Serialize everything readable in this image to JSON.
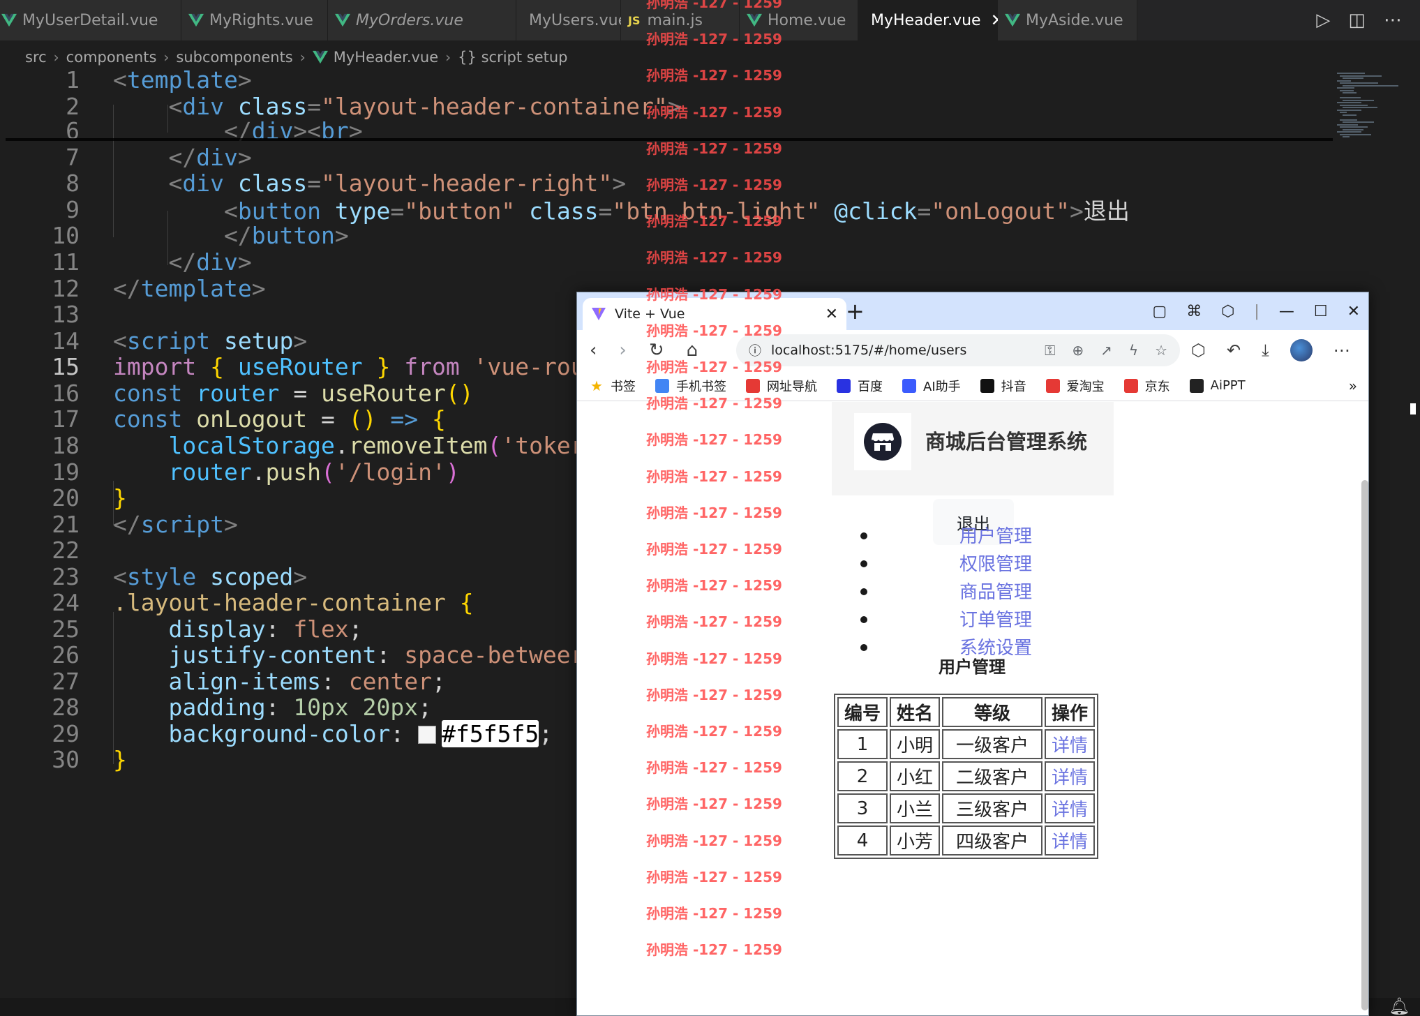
{
  "editor": {
    "tabs": [
      {
        "label": "MyUserDetail.vue",
        "type": "vue",
        "italic": false,
        "active": false
      },
      {
        "label": "MyRights.vue",
        "type": "vue",
        "italic": false,
        "active": false
      },
      {
        "label": "MyOrders.vue",
        "type": "vue",
        "italic": true,
        "active": false
      },
      {
        "label": "MyUsers.vue",
        "type": "vue",
        "italic": false,
        "active": false
      },
      {
        "label": "main.js",
        "type": "js",
        "italic": false,
        "active": false
      },
      {
        "label": "Home.vue",
        "type": "vue",
        "italic": false,
        "active": false
      },
      {
        "label": "MyHeader.vue",
        "type": "vue",
        "italic": false,
        "active": true
      },
      {
        "label": "MyAside.vue",
        "type": "vue",
        "italic": false,
        "active": false
      }
    ],
    "tab_close_icon": "close-icon",
    "js_badge": "JS",
    "actions": [
      "run-icon",
      "split-editor-icon",
      "more-icon"
    ],
    "breadcrumb": [
      "src",
      "components",
      "subcomponents",
      "MyHeader.vue",
      "{} script setup"
    ],
    "current_line": "15",
    "lines": [
      {
        "n": "1"
      },
      {
        "n": "2"
      },
      {
        "n": "6"
      },
      {
        "n": "7"
      },
      {
        "n": "8"
      },
      {
        "n": "9"
      },
      {
        "n": "10"
      },
      {
        "n": "11"
      },
      {
        "n": "12"
      },
      {
        "n": "13"
      },
      {
        "n": "14"
      },
      {
        "n": "15"
      },
      {
        "n": "16"
      },
      {
        "n": "17"
      },
      {
        "n": "18"
      },
      {
        "n": "19"
      },
      {
        "n": "20"
      },
      {
        "n": "21"
      },
      {
        "n": "22"
      },
      {
        "n": "23"
      },
      {
        "n": "24"
      },
      {
        "n": "25"
      },
      {
        "n": "26"
      },
      {
        "n": "27"
      },
      {
        "n": "28"
      },
      {
        "n": "29"
      },
      {
        "n": "30"
      }
    ],
    "code": {
      "l1": "template",
      "l2_tag": "div",
      "l2_attr": "class",
      "l2_val": "\"layout-header-container\"",
      "l6_close": "div",
      "l6_br": "br",
      "l7": "div",
      "l8_tag": "div",
      "l8_attr": "class",
      "l8_val": "\"layout-header-right\"",
      "l9_tag": "button",
      "l9_a1": "type",
      "l9_v1": "\"button\"",
      "l9_a2": "class",
      "l9_v2": "\"btn btn-light\"",
      "l9_a3": "@click",
      "l9_v3": "\"onLogout\"",
      "l9_text": "退出",
      "l10": "button",
      "l11": "div",
      "l12": "template",
      "l14_tag": "script",
      "l14_attr": "setup",
      "l15_kw": "import",
      "l15_name": "useRouter",
      "l15_from": "from",
      "l15_str": "'vue-rou",
      "l16_kw": "const",
      "l16_var": "router",
      "l16_fn": "useRouter",
      "l17_kw": "const",
      "l17_fn": "onLogout",
      "l18_obj": "localStorage",
      "l18_fn": "removeItem",
      "l18_str": "'toker",
      "l19_obj": "router",
      "l19_fn": "push",
      "l19_str": "'/login'",
      "l21": "script",
      "l23_tag": "style",
      "l23_attr": "scoped",
      "l24_sel": ".layout-header-container",
      "l25_prop": "display",
      "l25_val": "flex",
      "l26_prop": "justify-content",
      "l26_val": "space-betweer",
      "l27_prop": "align-items",
      "l27_val": "center",
      "l28_prop": "padding",
      "l28_val1": "10px",
      "l28_val2": "20px",
      "l29_prop": "background-color",
      "l29_val": "#f5f5f5"
    }
  },
  "watermark": {
    "text": "孙明浩 -127 - 1259",
    "count": 27
  },
  "browser": {
    "tab_title": "Vite + Vue",
    "tab_icon": "vite-logo-icon",
    "url": "localhost:5175/#/home/users",
    "bookmarks": [
      {
        "label": "书签",
        "icon": "star-icon",
        "color": "#f4b400"
      },
      {
        "label": "手机书签",
        "icon": "phone-icon",
        "color": "#4285f4"
      },
      {
        "label": "网址导航",
        "icon": "nav-icon",
        "color": "#e53935"
      },
      {
        "label": "百度",
        "icon": "baidu-icon",
        "color": "#2932e1"
      },
      {
        "label": "AI助手",
        "icon": "ai-icon",
        "color": "#3b5bfd"
      },
      {
        "label": "抖音",
        "icon": "douyin-icon",
        "color": "#111111"
      },
      {
        "label": "爱淘宝",
        "icon": "taobao-icon",
        "color": "#e53935"
      },
      {
        "label": "京东",
        "icon": "jd-icon",
        "color": "#e53935"
      },
      {
        "label": "AiPPT",
        "icon": "aippt-icon",
        "color": "#222222"
      }
    ],
    "bookmarks_more": "»",
    "page": {
      "app_title": "商城后台管理系统",
      "logout_label": "退出",
      "menu": [
        "用户管理",
        "权限管理",
        "商品管理",
        "订单管理",
        "系统设置"
      ],
      "section_title": "用户管理",
      "table": {
        "headers": [
          "编号",
          "姓名",
          "等级",
          "操作"
        ],
        "rows": [
          [
            "1",
            "小明",
            "一级客户",
            "详情"
          ],
          [
            "2",
            "小红",
            "二级客户",
            "详情"
          ],
          [
            "3",
            "小兰",
            "三级客户",
            "详情"
          ],
          [
            "4",
            "小芳",
            "四级客户",
            "详情"
          ]
        ]
      }
    }
  },
  "colors": {
    "editor_bg": "#1e1e1e",
    "vue_green": "#41b883",
    "link": "#6a73e0",
    "watermark": "#ff4b4b"
  }
}
